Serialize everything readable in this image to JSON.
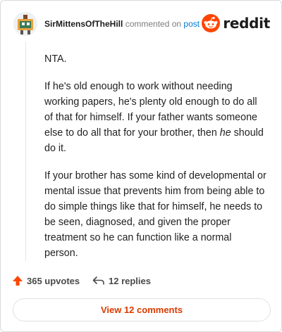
{
  "comment": {
    "username": "SirMittensOfTheHill",
    "action_text": "commented on",
    "post_link_text": "post",
    "paragraphs": [
      [
        "NTA."
      ],
      [
        "If he's old enough to work without needing",
        "working papers, he's plenty old enough to do all",
        "of that for himself. If your father wants someone",
        "else to do all that for your brother, then ",
        "do it."
      ],
      [
        "If your brother has some kind of developmental or",
        "mental issue that prevents him from being able to",
        "do simple things like that for himself, he needs to",
        "be seen, diagnosed, and given the proper",
        "treatment so he can function like a normal",
        "person."
      ]
    ],
    "emphasis_word": "he",
    "emphasis_tail": " should"
  },
  "brand": {
    "wordmark": "reddit",
    "accent_color": "#ff4500"
  },
  "footer": {
    "upvotes": "365 upvotes",
    "replies": "12 replies",
    "upvote_icon": "upvote-arrow-icon",
    "reply_icon": "reply-arrow-icon"
  },
  "view_button_label": "View 12 comments"
}
